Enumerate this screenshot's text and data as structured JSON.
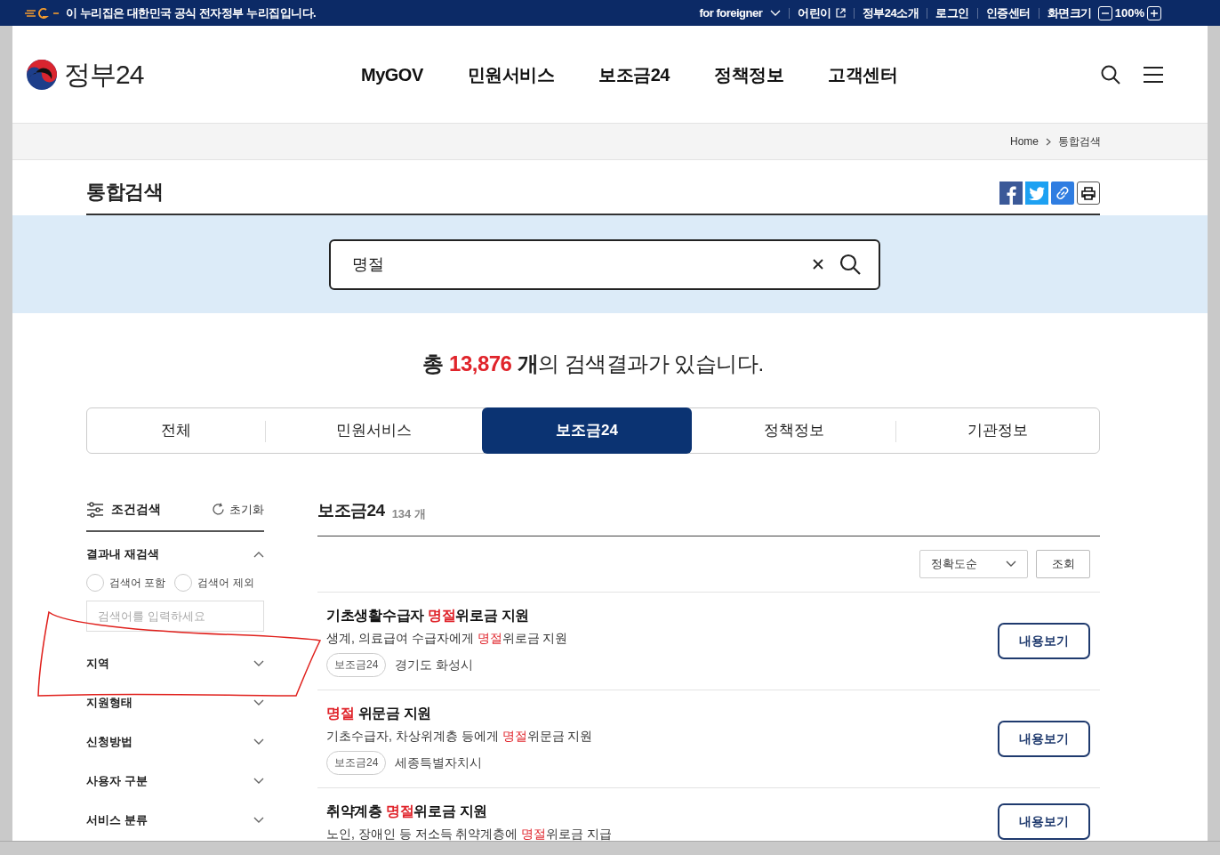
{
  "top_bar": {
    "notice": "이 누리집은 대한민국 공식 전자정부 누리집입니다.",
    "links": [
      {
        "label": "for foreigner",
        "kind": "dropdown"
      },
      {
        "label": "어린이",
        "kind": "external"
      },
      {
        "label": "정부24소개",
        "kind": "plain"
      },
      {
        "label": "로그인",
        "kind": "plain"
      },
      {
        "label": "인증센터",
        "kind": "plain"
      },
      {
        "label": "화면크기",
        "kind": "plain"
      }
    ],
    "zoom": {
      "value": "100%"
    }
  },
  "header": {
    "logo": "정부24",
    "nav": [
      "MyGOV",
      "민원서비스",
      "보조금24",
      "정책정보",
      "고객센터"
    ]
  },
  "breadcrumb": [
    "Home",
    "통합검색"
  ],
  "page_title": "통합검색",
  "search": {
    "value": "명절"
  },
  "result_summary": {
    "prefix": "총",
    "count": "13,876",
    "unit": "개",
    "rest": "의 검색결과가 있습니다."
  },
  "tabs": [
    {
      "label": "전체",
      "selected": false
    },
    {
      "label": "민원서비스",
      "selected": false
    },
    {
      "label": "보조금24",
      "selected": true
    },
    {
      "label": "정책정보",
      "selected": false
    },
    {
      "label": "기관정보",
      "selected": false
    }
  ],
  "filters": {
    "title": "조건검색",
    "reset": "초기화",
    "sections": [
      {
        "label": "결과내 재검색",
        "expanded": true,
        "options": [
          {
            "label": "검색어 포함",
            "selected": false
          },
          {
            "label": "검색어 제외",
            "selected": false
          }
        ],
        "placeholder": "검색어를 입력하세요"
      },
      {
        "label": "지역",
        "expanded": false
      },
      {
        "label": "지원형태",
        "expanded": false
      },
      {
        "label": "신청방법",
        "expanded": false
      },
      {
        "label": "사용자 구분",
        "expanded": false
      },
      {
        "label": "서비스 분류",
        "expanded": false
      }
    ]
  },
  "results": {
    "title": "보조금24",
    "count": "134 개",
    "sort": "정확도순",
    "query_button": "조회",
    "items": [
      {
        "title": [
          {
            "text": "기초생활수급자 ",
            "highlight": false
          },
          {
            "text": "명절",
            "highlight": true
          },
          {
            "text": "위로금 지원",
            "highlight": false
          }
        ],
        "description": [
          {
            "text": "생계, 의료급여 수급자에게 ",
            "highlight": false
          },
          {
            "text": "명절",
            "highlight": true
          },
          {
            "text": "위로금 지원",
            "highlight": false
          }
        ],
        "tag": "보조금24",
        "region": "경기도 화성시",
        "button": "내용보기"
      },
      {
        "title": [
          {
            "text": "명절",
            "highlight": true
          },
          {
            "text": " 위문금 지원",
            "highlight": false
          }
        ],
        "description": [
          {
            "text": "기초수급자, 차상위계층 등에게 ",
            "highlight": false
          },
          {
            "text": "명절",
            "highlight": true
          },
          {
            "text": "위문금 지원",
            "highlight": false
          }
        ],
        "tag": "보조금24",
        "region": "세종특별자치시",
        "button": "내용보기"
      },
      {
        "title": [
          {
            "text": "취약계층 ",
            "highlight": false
          },
          {
            "text": "명절",
            "highlight": true
          },
          {
            "text": "위로금 지원",
            "highlight": false
          }
        ],
        "description": [
          {
            "text": "노인, 장애인 등 저소득 취약계층에 ",
            "highlight": false
          },
          {
            "text": "명절",
            "highlight": true
          },
          {
            "text": "위로금 지급",
            "highlight": false
          }
        ],
        "button": "내용보기"
      }
    ]
  },
  "annotations": [
    {
      "kind": "freehand-outline"
    }
  ]
}
